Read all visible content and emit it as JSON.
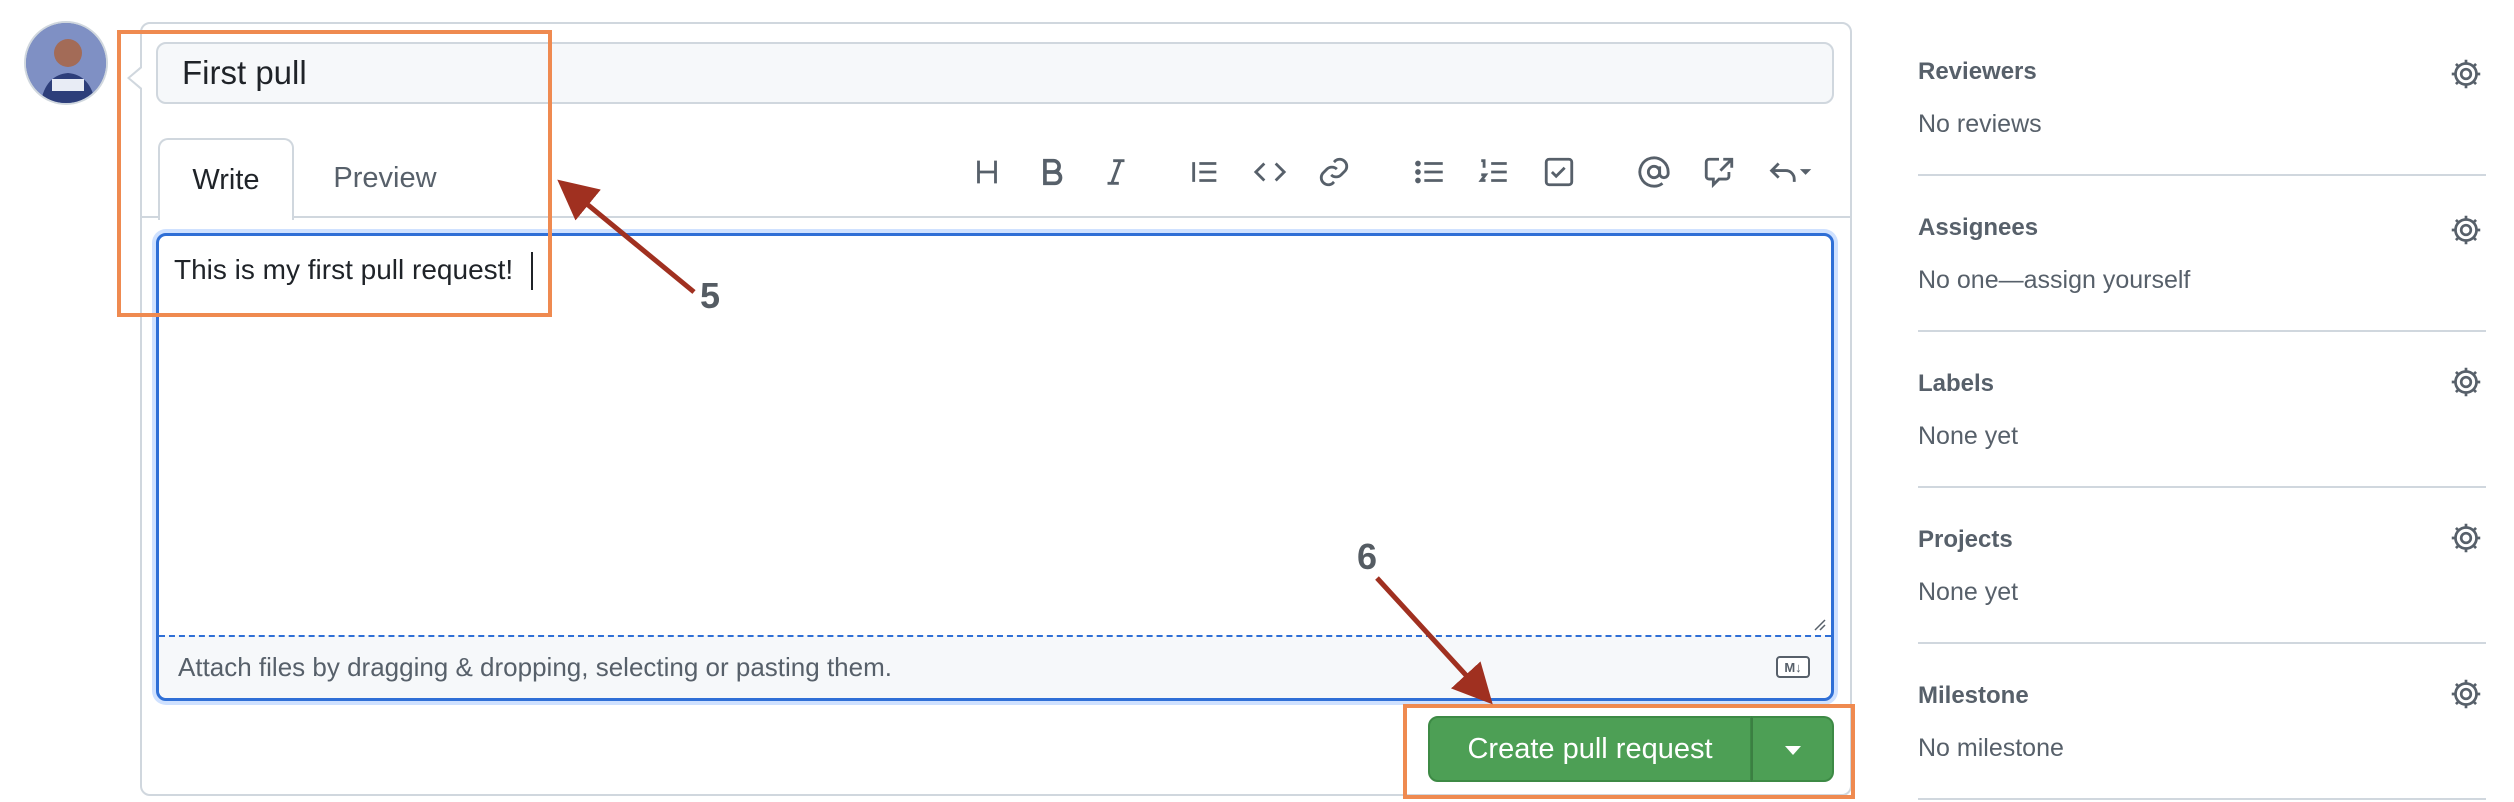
{
  "composer": {
    "title_value": "First pull",
    "tabs": [
      {
        "label": "Write",
        "active": true
      },
      {
        "label": "Preview",
        "active": false
      }
    ],
    "body_value": "This is my first pull request!",
    "attach_hint": "Attach files by dragging & dropping, selecting or pasting them.",
    "markdown_badge": "M↓",
    "toolbar_icons": [
      "heading-icon",
      "bold-icon",
      "italic-icon",
      "quote-icon",
      "code-icon",
      "link-icon",
      "bulleted-list-icon",
      "numbered-list-icon",
      "task-list-icon",
      "mention-icon",
      "cross-reference-icon",
      "reply-icon"
    ],
    "submit_label": "Create pull request",
    "submit_color": "#4d9f55"
  },
  "annotations": {
    "step_a": "5",
    "step_b": "6",
    "highlight_color": "#ef8a50",
    "arrow_color": "#a03020"
  },
  "sidebar": {
    "sections": [
      {
        "title": "Reviewers",
        "value": "No reviews"
      },
      {
        "title": "Assignees",
        "value": "No one—assign yourself"
      },
      {
        "title": "Labels",
        "value": "None yet"
      },
      {
        "title": "Projects",
        "value": "None yet"
      },
      {
        "title": "Milestone",
        "value": "No milestone"
      }
    ]
  }
}
